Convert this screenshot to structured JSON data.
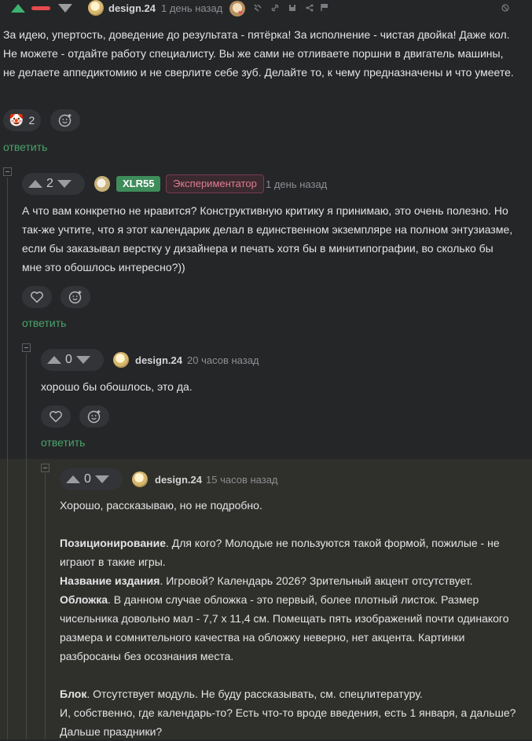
{
  "comment1": {
    "user": "design.24",
    "time": "1 день назад",
    "text": "За идею, упертость, доведение до результата - пятёрка! За исполнение - чистая двойка! Даже кол. Не можете - отдайте работу специалисту. Вы же сами не отливаете поршни в двигатель машины, не делаете аппедиктомию и не сверлите себе зуб. Делайте то, к чему предназначены и что умеете.",
    "reaction_emoji": "🤡",
    "reaction_count": "2",
    "reply_label": "ответить"
  },
  "comment2": {
    "votes": "2",
    "user": "XLR55",
    "badge": "Экспериментатор",
    "time": "1 день назад",
    "text": "А что вам конкретно не нравится? Конструктивную критику я принимаю, это очень полезно. Но так-же учтите, что я этот календарик делал в единственном экземпляре на полном энтузиазме, если бы заказывал верстку у дизайнера и печать хотя бы в минитипографии, во сколько бы мне это обошлось интересно?))",
    "reply_label": "ответить"
  },
  "comment3": {
    "votes": "0",
    "user": "design.24",
    "time": "20 часов назад",
    "text": "хорошо бы обошлось, это да.",
    "reply_label": "ответить"
  },
  "comment4": {
    "votes": "0",
    "user": "design.24",
    "time": "15 часов назад",
    "intro": "Хорошо, рассказываю, но не подробно.",
    "p1_bold": "Позиционирование",
    "p1_text": ". Для кого? Молодые не пользуются такой формой, пожилые - не играют в такие игры.",
    "p2_bold": "Название издания",
    "p2_text": ". Игровой? Календарь 2026? Зрительный акцент отсутствует.",
    "p3_bold": "Обложка",
    "p3_text": ". В данном случае обложка - это первый, более плотный листок. Размер чисельника довольно мал - 7,7 х 11,4 см. Помещать пять изображений почти одинакого размера и сомнительного качества на обложку неверно, нет акцента. Картинки разбросаны без осознания места.",
    "p4_bold": "Блок",
    "p4_text": ". Отсутствует модуль. Не буду рассказывать, см. спецлитературу.",
    "p5_text": "И, собственно, где календарь-то? Есть что-то вроде введения, есть 1 января, а дальше? Дальше праздники?"
  },
  "colors": {
    "accent": "#4aa36b",
    "background": "#252628",
    "highlight": "#2f302b"
  }
}
